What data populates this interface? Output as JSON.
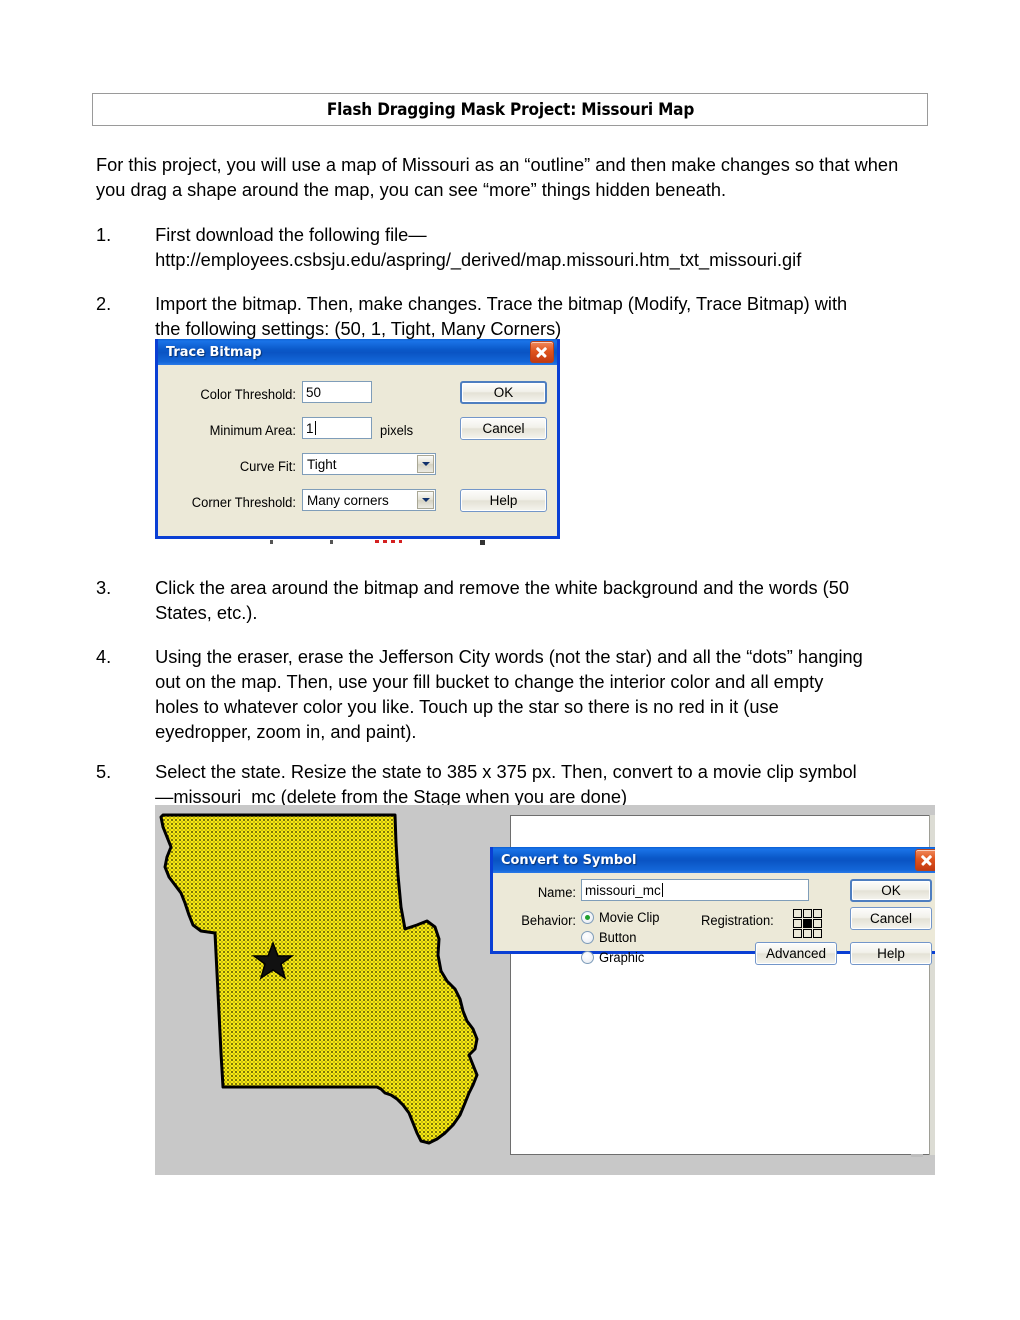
{
  "document": {
    "title": "Flash Dragging Mask Project: Missouri Map",
    "intro": "For this project, you will use a map of Missouri as an “outline” and then make changes so that when you drag a shape around the map, you can see “more” things hidden beneath.",
    "steps": [
      {
        "number": "1.",
        "text": "First download the following file— http://employees.csbsju.edu/aspring/_derived/map.missouri.htm_txt_missouri.gif"
      },
      {
        "number": "2.",
        "text": "Import the bitmap. Then, make changes. Trace the bitmap (Modify, Trace Bitmap) with the following settings: (50, 1, Tight, Many Corners)"
      },
      {
        "number": "3.",
        "text": "Click the area around the bitmap and remove the white background and the words (50 States, etc.)."
      },
      {
        "number": "4.",
        "text": "Using the eraser, erase the Jefferson City words (not the star) and all the “dots” hanging out on the map. Then, use your fill bucket to change the interior color and all empty holes to whatever color you like. Touch up the star so there is no red in it (use eyedropper, zoom in, and paint)."
      },
      {
        "number": "5.",
        "text": "Select the state. Resize the state to 385 x 375 px. Then, convert to a movie clip symbol—missouri_mc (delete from the Stage when you are done)"
      }
    ]
  },
  "trace_bitmap_dialog": {
    "title": "Trace Bitmap",
    "close_icon": "close-icon",
    "fields": {
      "color_threshold_label": "Color Threshold:",
      "color_threshold_value": "50",
      "minimum_area_label": "Minimum Area:",
      "minimum_area_value": "1",
      "minimum_area_suffix": "pixels",
      "curve_fit_label": "Curve Fit:",
      "curve_fit_value": "Tight",
      "corner_threshold_label": "Corner Threshold:",
      "corner_threshold_value": "Many corners"
    },
    "buttons": {
      "ok": "OK",
      "cancel": "Cancel",
      "help": "Help"
    }
  },
  "convert_to_symbol_dialog": {
    "title": "Convert to Symbol",
    "close_icon": "close-icon",
    "name_label": "Name:",
    "name_value": "missouri_mc",
    "behavior_label": "Behavior:",
    "behavior_options": [
      {
        "label": "Movie Clip",
        "selected": true
      },
      {
        "label": "Button",
        "selected": false
      },
      {
        "label": "Graphic",
        "selected": false
      }
    ],
    "registration_label": "Registration:",
    "registration_selected_index": 4,
    "buttons": {
      "ok": "OK",
      "cancel": "Cancel",
      "advanced": "Advanced",
      "help": "Help"
    }
  },
  "flash_stage": {
    "map_shape": "missouri-state-shape",
    "map_fill_color": "#f7e812",
    "map_outline_color": "#000000",
    "capital_marker": "star-icon",
    "workspace_color": "#c8c8c8",
    "stage_color": "#ffffff"
  }
}
